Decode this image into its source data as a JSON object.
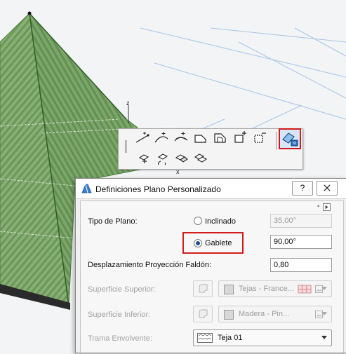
{
  "viewport": {
    "axis_z": "z",
    "axis_x": "x",
    "roof_color": "#6e9a5c",
    "roof_edge_color": "#5a8a4d"
  },
  "palette": {
    "tools": [
      {
        "name": "line-plane-icon"
      },
      {
        "name": "arc-plane-icon"
      },
      {
        "name": "curve-plane-icon"
      },
      {
        "name": "shape-plane-icon"
      },
      {
        "name": "cut-plane-icon"
      },
      {
        "name": "add-plane-icon"
      },
      {
        "name": "subtract-plane-icon"
      },
      {
        "name": "custom-plane-settings-icon"
      },
      {
        "name": "move-plane-icon"
      },
      {
        "name": "rotate-plane-icon"
      },
      {
        "name": "stretch-plane-icon"
      },
      {
        "name": "offset-plane-icon"
      }
    ]
  },
  "dialog": {
    "title": "Definiciones Plano Personalizado",
    "help_button": "?",
    "close_button": "X",
    "unit_indicator": "°",
    "plane_type_label": "Tipo de Plano:",
    "option_inclined": "Inclinado",
    "inclined_value": "35,00°",
    "option_gable": "Gablete",
    "gable_value": "90,00°",
    "eave_offset_label": "Desplazamiento Proyección Faldón:",
    "eave_offset_value": "0,80",
    "top_surface_label": "Superficie Superior:",
    "top_surface_value": "Tejas - France...",
    "bottom_surface_label": "Superficie Inferior:",
    "bottom_surface_value": "Madera - Pin...",
    "cover_fill_label": "Trama Envolvente:",
    "cover_fill_value": "Teja 01",
    "accent_color": "#d01c1c"
  }
}
